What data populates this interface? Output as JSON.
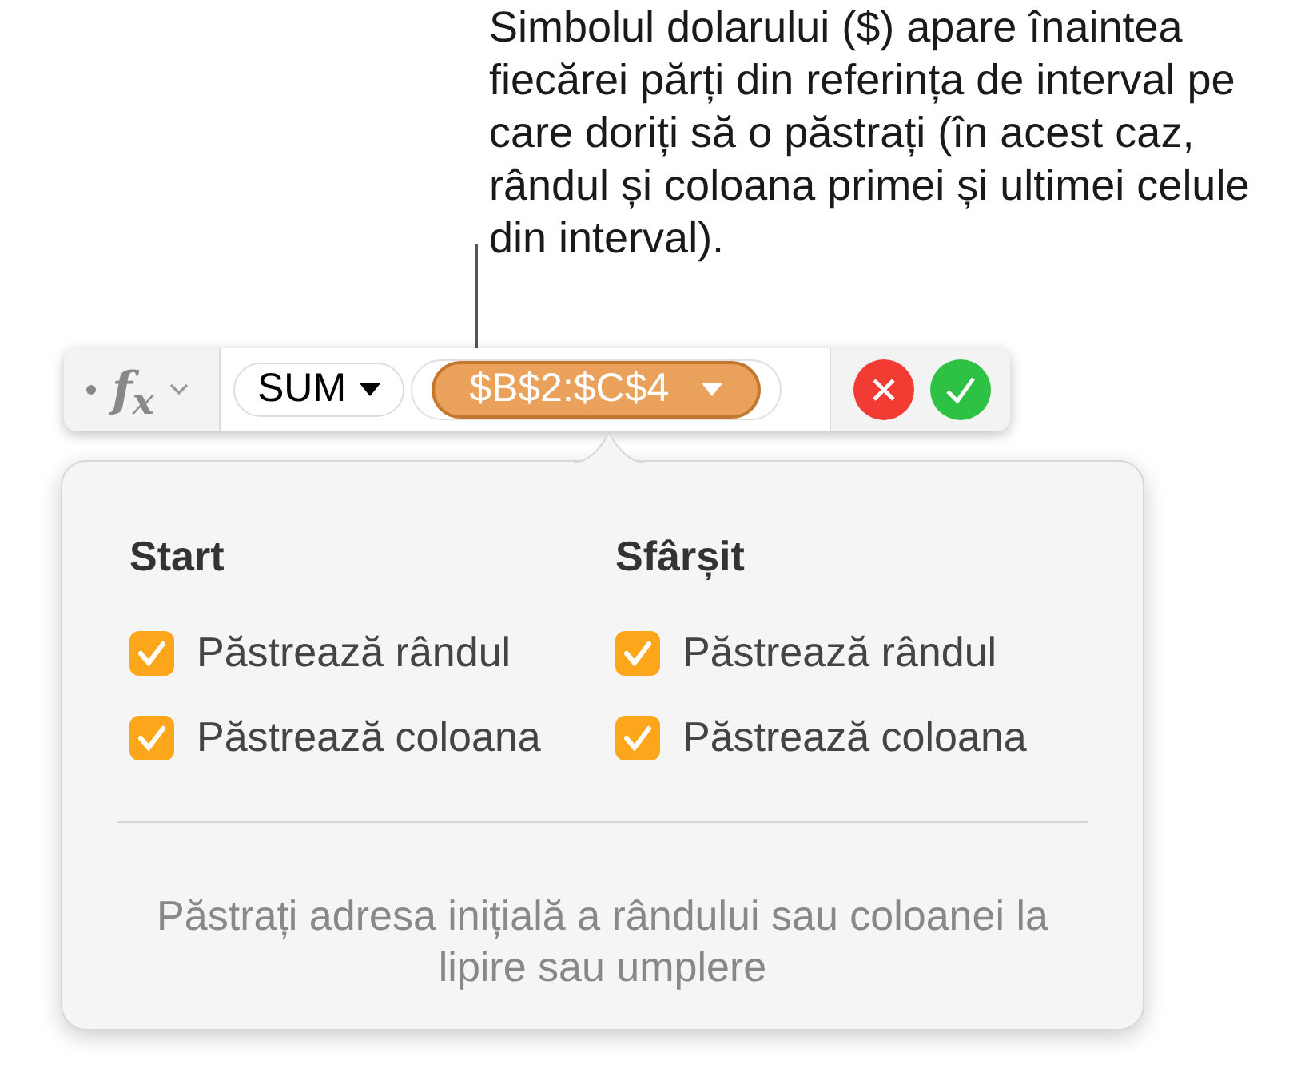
{
  "callout": {
    "text": "Simbolul dolarului ($) apare înaintea fiecărei părți din referința de interval pe care doriți să o păstrați (în acest caz, rândul și coloana primei și ultimei celule din interval)."
  },
  "formula_bar": {
    "function_label": "f$_{x}$",
    "tokens": [
      {
        "kind": "function",
        "text": "SUM",
        "selected": false
      },
      {
        "kind": "reference",
        "text": "$B$2:$C$4",
        "selected": true
      }
    ]
  },
  "popover": {
    "groups": [
      {
        "title": "Start",
        "options": [
          {
            "label": "Păstrează rândul",
            "checked": true
          },
          {
            "label": "Păstrează coloana",
            "checked": true
          }
        ]
      },
      {
        "title": "Sfârșit",
        "options": [
          {
            "label": "Păstrează rândul",
            "checked": true
          },
          {
            "label": "Păstrează coloana",
            "checked": true
          }
        ]
      }
    ],
    "footer": "Păstrați adresa inițială a rândului sau coloanei la lipire sau umplere"
  }
}
